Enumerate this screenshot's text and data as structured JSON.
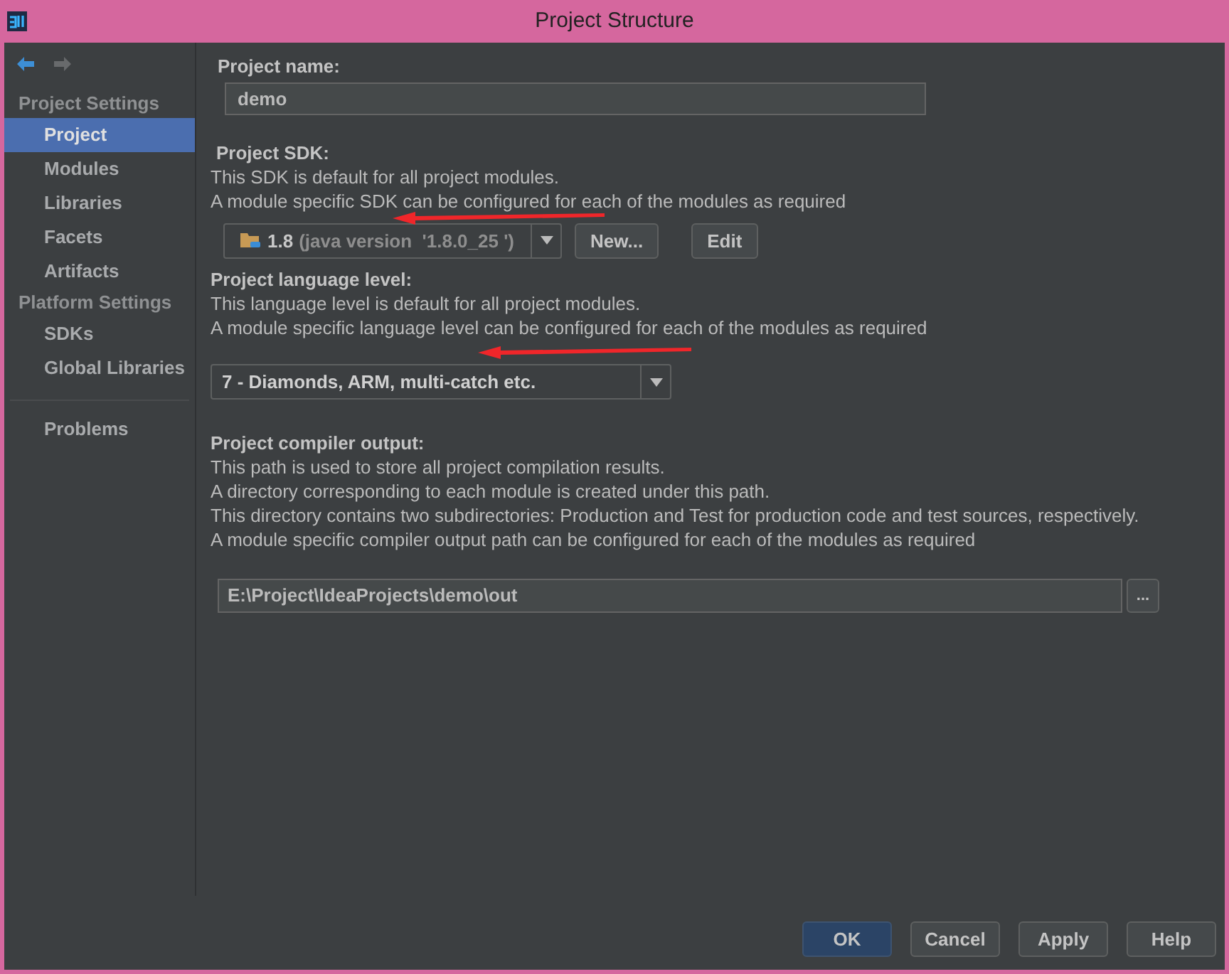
{
  "window": {
    "title": "Project Structure"
  },
  "nav": {
    "back_enabled": true,
    "forward_enabled": false
  },
  "sidebar": {
    "sections": [
      {
        "header": "Project Settings",
        "items": [
          {
            "label": "Project",
            "selected": true
          },
          {
            "label": "Modules",
            "selected": false
          },
          {
            "label": "Libraries",
            "selected": false
          },
          {
            "label": "Facets",
            "selected": false
          },
          {
            "label": "Artifacts",
            "selected": false
          }
        ]
      },
      {
        "header": "Platform Settings",
        "items": [
          {
            "label": "SDKs",
            "selected": false
          },
          {
            "label": "Global Libraries",
            "selected": false
          }
        ]
      },
      {
        "items": [
          {
            "label": "Problems",
            "selected": false
          }
        ]
      }
    ]
  },
  "project_name": {
    "label": "Project name:",
    "value": "demo"
  },
  "project_sdk": {
    "label": "Project SDK:",
    "description": [
      "This SDK is default for all project modules.",
      "A module specific SDK can be configured for each of the modules as required"
    ],
    "dropdown": {
      "version": "1.8",
      "detail": "(java version  '1.8.0_25 ')"
    },
    "buttons": [
      "New...",
      "Edit"
    ]
  },
  "language_level": {
    "label": "Project language level:",
    "description": [
      "This language level is default for all project modules.",
      "A module specific language level can be configured for each of the modules as required"
    ],
    "dropdown": {
      "value": "7 - Diamonds, ARM, multi-catch etc."
    }
  },
  "compiler_output": {
    "label": "Project compiler output:",
    "description": [
      "This path is used to store all project compilation results.",
      "A directory corresponding to each module is created under this path.",
      "This directory contains two subdirectories: Production and Test for production code and test sources, respectively.",
      "A module specific compiler output path can be configured for each of the modules as required"
    ],
    "value": "E:\\Project\\IdeaProjects\\demo\\out",
    "browse": "..."
  },
  "buttons": [
    {
      "label": "OK",
      "default": true
    },
    {
      "label": "Cancel",
      "default": false
    },
    {
      "label": "Apply",
      "default": false
    },
    {
      "label": "Help",
      "default": false
    }
  ]
}
